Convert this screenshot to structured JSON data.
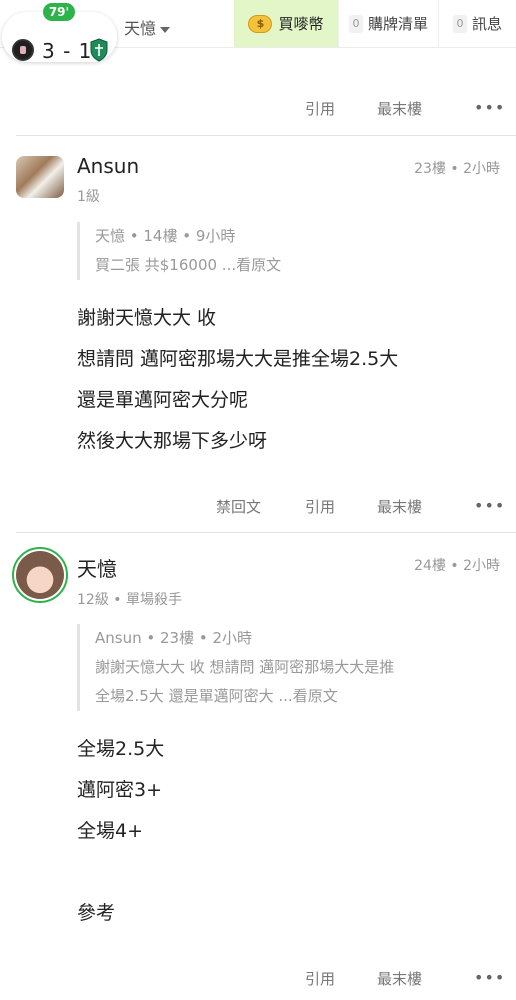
{
  "topbar": {
    "match_minute": "79'",
    "score": "3 - 1",
    "username": "天憶",
    "buy_coins_label": "買嘜幣",
    "cart_count": "0",
    "cart_label": "購牌清單",
    "msg_count": "0",
    "msg_label": "訊息"
  },
  "actions_top": {
    "quote": "引用",
    "last": "最末樓",
    "more": "•••"
  },
  "posts": [
    {
      "username": "Ansun",
      "level": "1級",
      "floor": "23樓 • 2小時",
      "quote_meta": "天憶 • 14樓 • 9小時",
      "quote_lines": [
        "買二張 共$16000 ...看原文"
      ],
      "body_lines": [
        "謝謝天憶大大 收",
        "想請問 邁阿密那場大大是推全場2.5大",
        "還是單邁阿密大分呢",
        "然後大大那場下多少呀"
      ],
      "actions": {
        "ban": "禁回文",
        "quote": "引用",
        "last": "最末樓",
        "more": "•••"
      }
    },
    {
      "username": "天憶",
      "level": "12級 • 單場殺手",
      "floor": "24樓 • 2小時",
      "quote_meta": "Ansun • 23樓 • 2小時",
      "quote_lines": [
        "謝謝天憶大大 收 想請問 邁阿密那場大大是推",
        "全場2.5大 還是單邁阿密大 ...看原文"
      ],
      "body_lines": [
        "全場2.5大",
        "邁阿密3+",
        "全場4+",
        "",
        "參考"
      ],
      "actions": {
        "quote": "引用",
        "last": "最末樓",
        "more": "•••"
      }
    }
  ]
}
